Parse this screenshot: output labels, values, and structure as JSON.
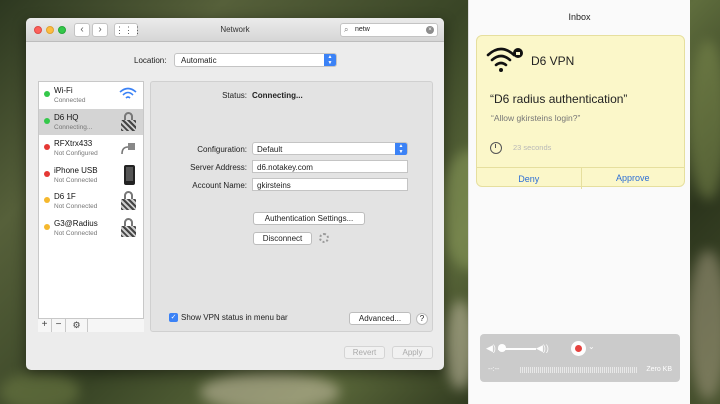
{
  "window": {
    "title": "Network",
    "search_value": "netw",
    "location_label": "Location:",
    "location_value": "Automatic"
  },
  "services": [
    {
      "name": "Wi-Fi",
      "status": "Connected",
      "color": "#34c84a",
      "icon": "wifi-icon"
    },
    {
      "name": "D6 HQ",
      "status": "Connecting...",
      "color": "#34c84a",
      "icon": "vpn-lock-icon"
    },
    {
      "name": "RFXtrx433",
      "status": "Not Configured",
      "color": "#e53935",
      "icon": "usb-plug-icon"
    },
    {
      "name": "iPhone USB",
      "status": "Not Connected",
      "color": "#e53935",
      "icon": "iphone-icon"
    },
    {
      "name": "D6 1F",
      "status": "Not Connected",
      "color": "#f5b82e",
      "icon": "vpn-lock-icon"
    },
    {
      "name": "G3@Radius",
      "status": "Not Connected",
      "color": "#f5b82e",
      "icon": "vpn-lock-icon"
    }
  ],
  "list_toolbar": {
    "add": "+",
    "remove": "−",
    "gear": "⚙"
  },
  "detail": {
    "status_label": "Status:",
    "status_value": "Connecting...",
    "configuration_label": "Configuration:",
    "configuration_value": "Default",
    "server_label": "Server Address:",
    "server_value": "d6.notakey.com",
    "account_label": "Account Name:",
    "account_value": "gkirsteins",
    "auth_button": "Authentication Settings...",
    "disconnect_button": "Disconnect",
    "show_vpn_label": "Show VPN status in menu bar",
    "show_vpn_checked": true,
    "advanced_button": "Advanced...",
    "help": "?"
  },
  "footer": {
    "revert": "Revert",
    "apply": "Apply"
  },
  "notification_panel": {
    "title": "Inbox",
    "app_name": "D6 VPN",
    "heading": "“D6 radius authentication”",
    "subtext": "“Allow gkirsteins login?”",
    "timer": "23 seconds",
    "deny": "Deny",
    "approve": "Approve",
    "card_color": "#fbf7c9"
  },
  "recorder": {
    "time": "--:--",
    "size": "Zero KB",
    "record_color": "#e53935"
  }
}
